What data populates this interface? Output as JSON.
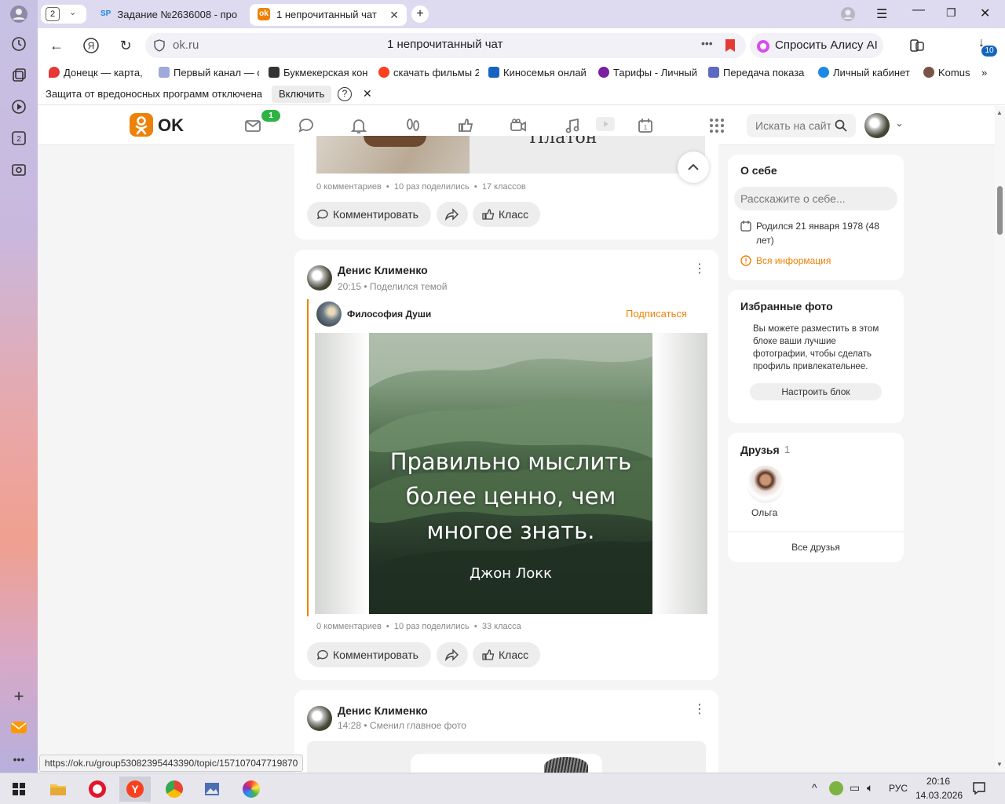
{
  "browser": {
    "tab_count": "2",
    "tabs": [
      {
        "favicon": "SP",
        "label": "Задание №2636008 - про"
      },
      {
        "favicon": "ok-icon",
        "label": "1 непрочитанный чат"
      }
    ],
    "url": "ok.ru",
    "page_title": "1 непрочитанный чат",
    "alice_label": "Спросить Алису AI",
    "downloads_badge": "10",
    "bookmarks": [
      {
        "icon": "map-pin-icon",
        "label": "Донецк — карта, с",
        "color": "#e53935"
      },
      {
        "icon": "tv-icon",
        "label": "Первый канал — с",
        "color": "#3949ab"
      },
      {
        "icon": "bookmaker-icon",
        "label": "Букмекерская кон",
        "color": "#333333"
      },
      {
        "icon": "yandex-icon",
        "label": "скачать фильмы 2",
        "color": "#fc3f1d"
      },
      {
        "icon": "monitor-icon",
        "label": "Киносемья онлай",
        "color": "#1565c0"
      },
      {
        "icon": "tariff-icon",
        "label": "Тарифы - Личный",
        "color": "#7b1fa2"
      },
      {
        "icon": "transfer-icon",
        "label": "Передача показа",
        "color": "#3f51b5"
      },
      {
        "icon": "drop-icon",
        "label": "Личный кабинет",
        "color": "#1e88e5"
      },
      {
        "icon": "komus-icon",
        "label": "Komus",
        "color": "#795548"
      }
    ],
    "notice_text": "Защита от вредоносных программ отключена",
    "notice_button": "Включить",
    "status_url": "https://ok.ru/group53082395443390/topic/157107047719870"
  },
  "ok": {
    "logo_text": "OK",
    "messages_badge": "1",
    "search_placeholder": "Искать на сайте",
    "colors": {
      "brand": "#ee8208",
      "badge": "#2fb344"
    }
  },
  "feed": {
    "post1": {
      "partial_image_text": "Платон",
      "stats": [
        "0 комментариев",
        "10 раз поделились",
        "17 классов"
      ],
      "comment_label": "Комментировать",
      "like_label": "Класс"
    },
    "post2": {
      "author": "Денис Клименко",
      "time": "20:15",
      "action": "Поделился темой",
      "group_name": "Философия Души",
      "subscribe_label": "Подписаться",
      "quote_lines": [
        "Правильно мыслить",
        "более ценно, чем",
        "многое знать."
      ],
      "quote_author": "Джон Локк",
      "stats": [
        "0 комментариев",
        "10 раз поделились",
        "33 класса"
      ],
      "comment_label": "Комментировать",
      "like_label": "Класс"
    },
    "post3": {
      "author": "Денис Клименко",
      "time": "14:28",
      "action": "Сменил главное фото"
    }
  },
  "right": {
    "about": {
      "title": "О себе",
      "placeholder": "Расскажите о себе...",
      "birth": "Родился 21 января 1978 (48 лет)",
      "all_info": "Вся информация"
    },
    "photos": {
      "title": "Избранные фото",
      "description": "Вы можете разместить в этом блоке ваши лучшие фотографии, чтобы сделать профиль привлекательнее.",
      "button": "Настроить блок"
    },
    "friends": {
      "title": "Друзья",
      "count": "1",
      "friend_name": "Ольга",
      "all_label": "Все друзья"
    }
  },
  "taskbar": {
    "lang": "РУС",
    "time": "20:16",
    "date": "14.03.2026"
  }
}
